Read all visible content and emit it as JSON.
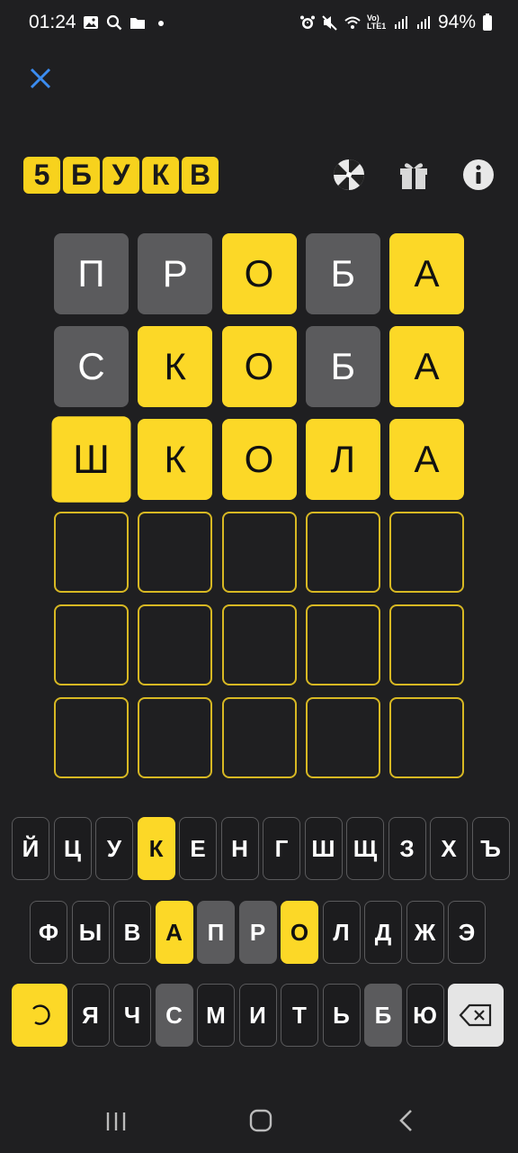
{
  "status_bar": {
    "time": "01:24",
    "battery": "94%",
    "network": "Vo) LTE1"
  },
  "header": {
    "logo_letters": [
      "5",
      "Б",
      "У",
      "К",
      "В"
    ],
    "icons": [
      "wheel-icon",
      "gift-icon",
      "info-icon"
    ]
  },
  "board": {
    "rows": [
      [
        {
          "l": "П",
          "s": "gray"
        },
        {
          "l": "Р",
          "s": "gray"
        },
        {
          "l": "О",
          "s": "yellow"
        },
        {
          "l": "Б",
          "s": "gray"
        },
        {
          "l": "А",
          "s": "yellow"
        }
      ],
      [
        {
          "l": "С",
          "s": "gray"
        },
        {
          "l": "К",
          "s": "yellow"
        },
        {
          "l": "О",
          "s": "yellow"
        },
        {
          "l": "Б",
          "s": "gray"
        },
        {
          "l": "А",
          "s": "yellow"
        }
      ],
      [
        {
          "l": "Ш",
          "s": "yellow"
        },
        {
          "l": "К",
          "s": "yellow"
        },
        {
          "l": "О",
          "s": "yellow"
        },
        {
          "l": "Л",
          "s": "yellow"
        },
        {
          "l": "А",
          "s": "yellow"
        }
      ],
      [
        {
          "l": "",
          "s": "empty"
        },
        {
          "l": "",
          "s": "empty"
        },
        {
          "l": "",
          "s": "empty"
        },
        {
          "l": "",
          "s": "empty"
        },
        {
          "l": "",
          "s": "empty"
        }
      ],
      [
        {
          "l": "",
          "s": "empty"
        },
        {
          "l": "",
          "s": "empty"
        },
        {
          "l": "",
          "s": "empty"
        },
        {
          "l": "",
          "s": "empty"
        },
        {
          "l": "",
          "s": "empty"
        }
      ],
      [
        {
          "l": "",
          "s": "empty"
        },
        {
          "l": "",
          "s": "empty"
        },
        {
          "l": "",
          "s": "empty"
        },
        {
          "l": "",
          "s": "empty"
        },
        {
          "l": "",
          "s": "empty"
        }
      ]
    ]
  },
  "keyboard": {
    "row1": [
      {
        "k": "Й",
        "s": "n"
      },
      {
        "k": "Ц",
        "s": "n"
      },
      {
        "k": "У",
        "s": "n"
      },
      {
        "k": "К",
        "s": "y"
      },
      {
        "k": "Е",
        "s": "n"
      },
      {
        "k": "Н",
        "s": "n"
      },
      {
        "k": "Г",
        "s": "n"
      },
      {
        "k": "Ш",
        "s": "n"
      },
      {
        "k": "Щ",
        "s": "n"
      },
      {
        "k": "З",
        "s": "n"
      },
      {
        "k": "Х",
        "s": "n"
      },
      {
        "k": "Ъ",
        "s": "n"
      }
    ],
    "row2": [
      {
        "k": "Ф",
        "s": "n"
      },
      {
        "k": "Ы",
        "s": "n"
      },
      {
        "k": "В",
        "s": "n"
      },
      {
        "k": "А",
        "s": "y"
      },
      {
        "k": "П",
        "s": "g"
      },
      {
        "k": "Р",
        "s": "g"
      },
      {
        "k": "О",
        "s": "y"
      },
      {
        "k": "Л",
        "s": "n"
      },
      {
        "k": "Д",
        "s": "n"
      },
      {
        "k": "Ж",
        "s": "n"
      },
      {
        "k": "Э",
        "s": "n"
      }
    ],
    "row3": [
      {
        "k": "",
        "s": "y",
        "icon": "loading-icon"
      },
      {
        "k": "Я",
        "s": "n"
      },
      {
        "k": "Ч",
        "s": "n"
      },
      {
        "k": "С",
        "s": "g"
      },
      {
        "k": "М",
        "s": "n"
      },
      {
        "k": "И",
        "s": "n"
      },
      {
        "k": "Т",
        "s": "n"
      },
      {
        "k": "Ь",
        "s": "n"
      },
      {
        "k": "Б",
        "s": "g"
      },
      {
        "k": "Ю",
        "s": "n"
      },
      {
        "k": "",
        "s": "l",
        "icon": "backspace-icon"
      }
    ]
  },
  "colors": {
    "yellow": "#fcd827",
    "gray": "#5b5b5d",
    "background": "#1f1f21",
    "close_icon": "#3b8cf0"
  }
}
